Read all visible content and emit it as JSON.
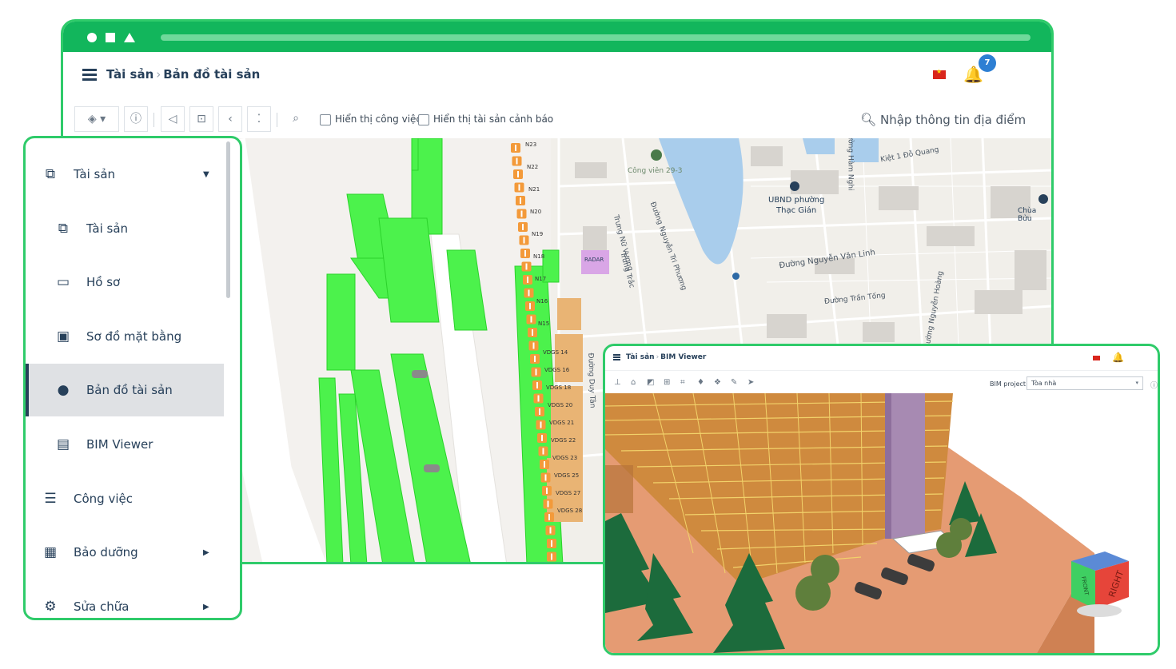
{
  "header": {
    "breadcrumb_root": "Tài sản",
    "breadcrumb_current": "Bản đồ tài sản",
    "notification_count": "7"
  },
  "toolbar": {
    "show_tasks_label": "Hiển thị công việc",
    "show_warning_assets_label": "Hiển thị tài sản cảnh báo",
    "search_placeholder": "Nhập thông tin địa điểm"
  },
  "map_labels": {
    "park": "Công viên 29-3",
    "ward": "UBND phường",
    "ward2": "Thạc Gián",
    "street1": "Đường Nguyễn Văn Linh",
    "street2": "Đường Trần Tống",
    "street3": "Đường Nguyễn Tri Phương",
    "street4": "Đường Duy Tân",
    "street5": "Đường Hàm Nghi",
    "street6": "Kiệt 1 Đỗ Quang",
    "pagoda": "Chùa Bửu",
    "radar": "RADAR",
    "street7": "Trưng Nữ Vương",
    "street8": "Đường Nguyễn Hoàng",
    "street9": "Trưng Trắc"
  },
  "gate_labels": [
    "VDGS 14",
    "VDGS 16",
    "VDGS 18",
    "VDGS 20",
    "VDGS 21",
    "VDGS 22",
    "VDGS 23",
    "VDGS 25",
    "VDGS 27",
    "VDGS 28"
  ],
  "stand_labels": [
    "N23",
    "N22",
    "N21",
    "N20",
    "N19",
    "N18",
    "N17",
    "N16",
    "N15"
  ],
  "sidebar": {
    "items": [
      {
        "label": "Tài sản",
        "icon": "cubes-icon",
        "level": 0,
        "active": false,
        "caret": "down"
      },
      {
        "label": "Tài sản",
        "icon": "cubes-icon",
        "level": 1,
        "active": false
      },
      {
        "label": "Hồ sơ",
        "icon": "folder-icon",
        "level": 1,
        "active": false
      },
      {
        "label": "Sơ đồ mặt bằng",
        "icon": "floorplan-icon",
        "level": 1,
        "active": false
      },
      {
        "label": "Bản đồ tài sản",
        "icon": "globe-icon",
        "level": 1,
        "active": true
      },
      {
        "label": "BIM Viewer",
        "icon": "building-icon",
        "level": 1,
        "active": false
      },
      {
        "label": "Công việc",
        "icon": "tasks-icon",
        "level": 0,
        "active": false
      },
      {
        "label": "Bảo dưỡng",
        "icon": "calendar-icon",
        "level": 0,
        "active": false,
        "caret": "right"
      },
      {
        "label": "Sửa chữa",
        "icon": "repair-icon",
        "level": 0,
        "active": false,
        "caret": "right"
      }
    ]
  },
  "bim": {
    "breadcrumb_root": "Tài sản",
    "breadcrumb_current": "BIM Viewer",
    "project_label": "BIM project:",
    "project_value": "Tòa nhà",
    "cube_front": "FRONT",
    "cube_right": "RIGHT"
  },
  "colors": {
    "brand_green": "#12b65c",
    "frame_green": "#2fcb6a",
    "asset_green": "#4cf24c",
    "nav_text": "#27405a",
    "badge_blue": "#2d7fd3"
  }
}
